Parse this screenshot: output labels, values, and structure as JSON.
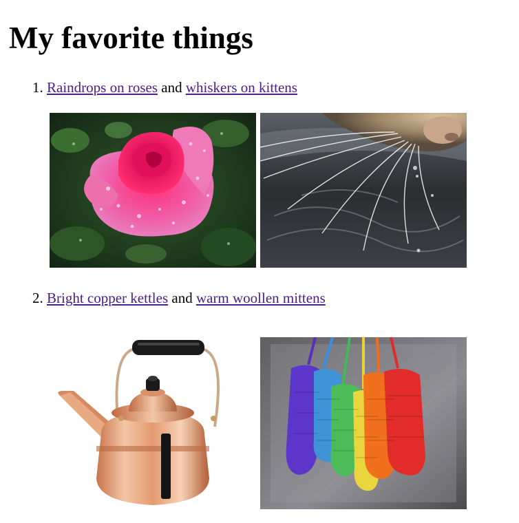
{
  "page": {
    "title": "My favorite things"
  },
  "items": [
    {
      "number": "1.",
      "link_a": "Raindrops on roses",
      "joiner": " and ",
      "link_b": "whiskers on kittens"
    },
    {
      "number": "2.",
      "link_a": "Bright copper kettles",
      "joiner": " and ",
      "link_b": "warm woollen mittens"
    }
  ],
  "colors": {
    "link_visited": "#4b1c8a",
    "text": "#000000",
    "background": "#ffffff"
  },
  "images": [
    {
      "name": "rose-photo",
      "depicts": "rose"
    },
    {
      "name": "cat-whiskers-photo",
      "depicts": "whiskers"
    },
    {
      "name": "copper-kettle-photo",
      "depicts": "kettle"
    },
    {
      "name": "knitted-mittens-photo",
      "depicts": "mittens"
    }
  ]
}
